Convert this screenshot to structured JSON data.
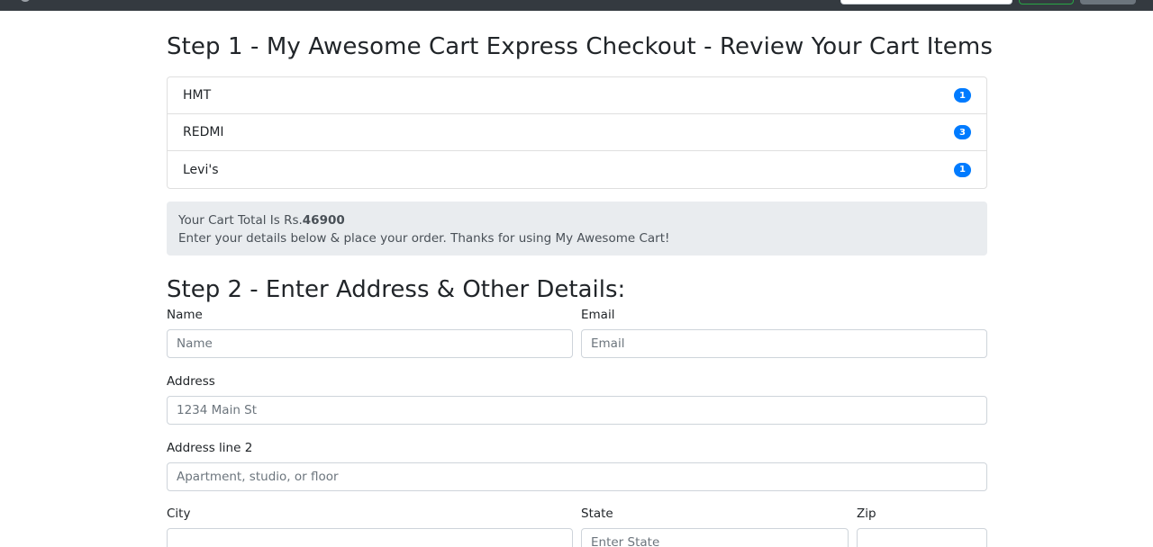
{
  "navbar": {
    "search_placeholder": ""
  },
  "step1": {
    "title": "Step 1 - My Awesome Cart Express Checkout - Review Your Cart Items"
  },
  "cart_items": [
    {
      "name": "HMT",
      "qty": "1"
    },
    {
      "name": "REDMI",
      "qty": "3"
    },
    {
      "name": "Levi's",
      "qty": "1"
    }
  ],
  "summary": {
    "total_prefix": "Your Cart Total Is Rs.",
    "total_value": "46900",
    "message": "Enter your details below & place your order. Thanks for using My Awesome Cart!"
  },
  "step2": {
    "title": "Step 2 - Enter Address & Other Details:"
  },
  "form": {
    "name_label": "Name",
    "name_placeholder": "Name",
    "email_label": "Email",
    "email_placeholder": "Email",
    "address_label": "Address",
    "address_placeholder": "1234 Main St",
    "address2_label": "Address line 2",
    "address2_placeholder": "Apartment, studio, or floor",
    "city_label": "City",
    "city_placeholder": "",
    "state_label": "State",
    "state_placeholder": "Enter State",
    "zip_label": "Zip",
    "zip_placeholder": ""
  },
  "colors": {
    "navbar": "#343a40",
    "badge": "#007bff",
    "alert_bg": "#e9ecef"
  }
}
